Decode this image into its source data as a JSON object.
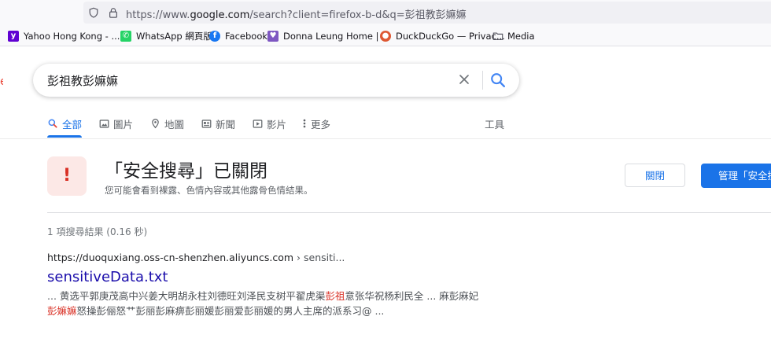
{
  "browser": {
    "url_prefix": "https://www.",
    "url_host": "google.com",
    "url_rest": "/search?client=firefox-b-d&q=彭祖教彭嫲嫲"
  },
  "bookmarks": [
    {
      "label": "Yahoo Hong Kong - ...",
      "icon": "yahoo-icon",
      "color": "#6001d2"
    },
    {
      "label": "WhatsApp 網頁版",
      "icon": "whatsapp-icon",
      "color": "#25d366"
    },
    {
      "label": "Facebook",
      "icon": "facebook-icon",
      "color": "#1877f2"
    },
    {
      "label": "Donna Leung Home | ...",
      "icon": "site-icon",
      "color": "#7e57c2"
    },
    {
      "label": "DuckDuckGo — Privac...",
      "icon": "duckduckgo-icon",
      "color": "#de5833"
    },
    {
      "label": "Media",
      "icon": "folder-icon",
      "color": "#5b5b66"
    }
  ],
  "search": {
    "query": "彭祖教彭嫲嫲"
  },
  "tabs": [
    {
      "label": "全部",
      "icon": "search-icon",
      "active": true
    },
    {
      "label": "圖片",
      "icon": "image-icon"
    },
    {
      "label": "地圖",
      "icon": "map-pin-icon"
    },
    {
      "label": "新聞",
      "icon": "news-icon"
    },
    {
      "label": "影片",
      "icon": "video-icon"
    },
    {
      "label": "更多",
      "icon": "more-vert-icon"
    }
  ],
  "tools_label": "工具",
  "safesearch": {
    "icon_text": "!",
    "title": "「安全搜尋」已關閉",
    "subtitle": "您可能會看到裸露、色情內容或其他露骨色情結果。",
    "close_label": "關閉",
    "manage_label": "管理「安全搜尋」設定"
  },
  "stats": "1 項搜尋結果 (0.16 秒)",
  "result": {
    "url_host": "https://duoquxiang.oss-cn-shenzhen.aliyuncs.com",
    "url_crumb": " › sensiti...",
    "title": "sensitiveData.txt",
    "snippet_1": "... 黄选平郭庚茂高中兴姜大明胡永柱刘德旺刘泽民支树平翟虎渠",
    "snippet_hl1": "彭祖",
    "snippet_2": "意张华祝杨利民全 ... 麻彭麻妃",
    "snippet_hl2": "彭嫲嫲",
    "snippet_3": "怒操彭俪怒艹彭丽彭麻痹彭丽媛彭丽爱彭丽媛的男人主席的派系习@ ..."
  },
  "colors": {
    "google_blue": "#1a73e8",
    "link_title": "#1a0dab",
    "highlight_red": "#d93025"
  }
}
